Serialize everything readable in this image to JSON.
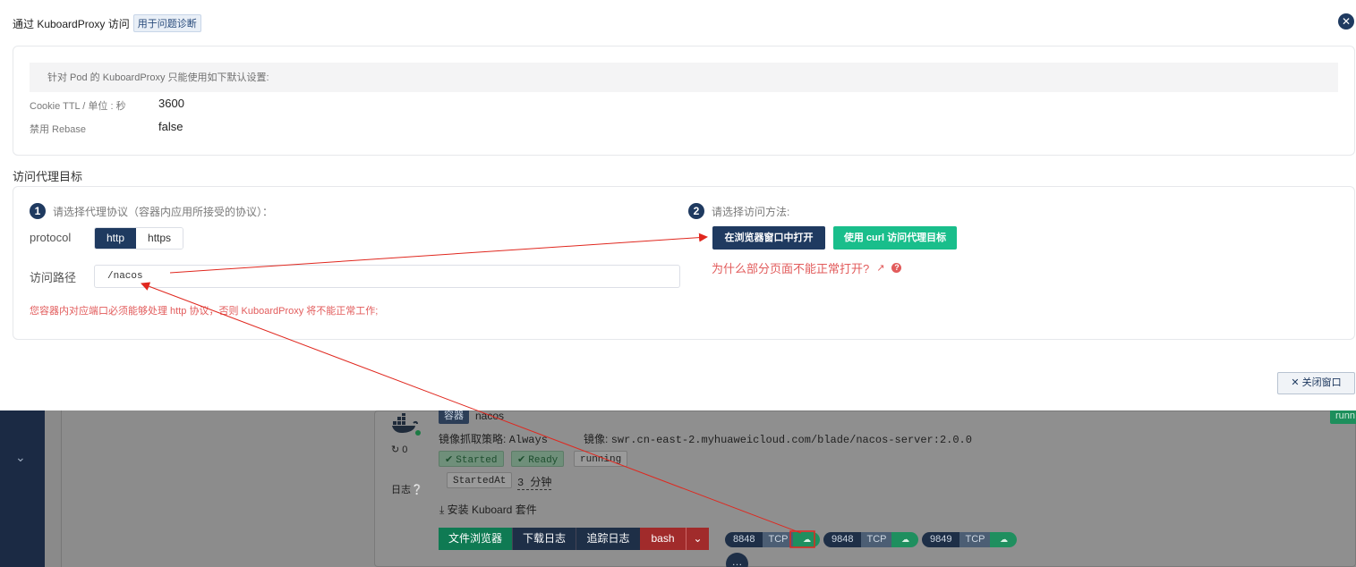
{
  "dialog": {
    "title": "通过 KuboardProxy 访问",
    "title_tag": "用于问题诊断",
    "notice": "针对 Pod 的 KuboardProxy 只能使用如下默认设置:",
    "settings": [
      {
        "label": "Cookie TTL / 单位 : 秒",
        "value": "3600"
      },
      {
        "label": "禁用 Rebase",
        "value": "false"
      }
    ],
    "section_title": "访问代理目标",
    "step1": {
      "num": "1",
      "text": "请选择代理协议（容器内应用所接受的协议）："
    },
    "protocol_label": "protocol",
    "protocols": [
      "http",
      "https"
    ],
    "selected_protocol": "http",
    "path_label": "访问路径",
    "path_value": "/nacos",
    "warning": "您容器内对应端口必须能够处理 http 协议，否则 KuboardProxy 将不能正常工作;",
    "step2": {
      "num": "2",
      "text": "请选择访问方法:"
    },
    "open_browser_label": "在浏览器窗口中打开",
    "curl_label": "使用 curl 访问代理目标",
    "why_link": "为什么部分页面不能正常打开?",
    "close_label": "关闭窗口",
    "colors": {
      "primary": "#1f3a60",
      "success": "#19be8b",
      "danger": "#e25b5b"
    }
  },
  "background": {
    "container_tag": "容器",
    "container_name": "nacos",
    "restart_count": "0",
    "pull_policy_label": "镜像抓取策略:",
    "pull_policy": "Always",
    "image_label": "镜像:",
    "image": "swr.cn-east-2.myhuaweicloud.com/blade/nacos-server:2.0.0",
    "started": "Started",
    "ready": "Ready",
    "running": "running",
    "started_at_label": "StartedAt",
    "started_at": "3 分钟",
    "logs_label": "日志",
    "install_suite": "安装 Kuboard 套件",
    "buttons": [
      "文件浏览器",
      "下载日志",
      "追踪日志",
      "bash"
    ],
    "ports": [
      {
        "port": "8848",
        "proto": "TCP"
      },
      {
        "port": "9848",
        "proto": "TCP"
      },
      {
        "port": "9849",
        "proto": "TCP"
      }
    ],
    "right_tag": "runn"
  }
}
